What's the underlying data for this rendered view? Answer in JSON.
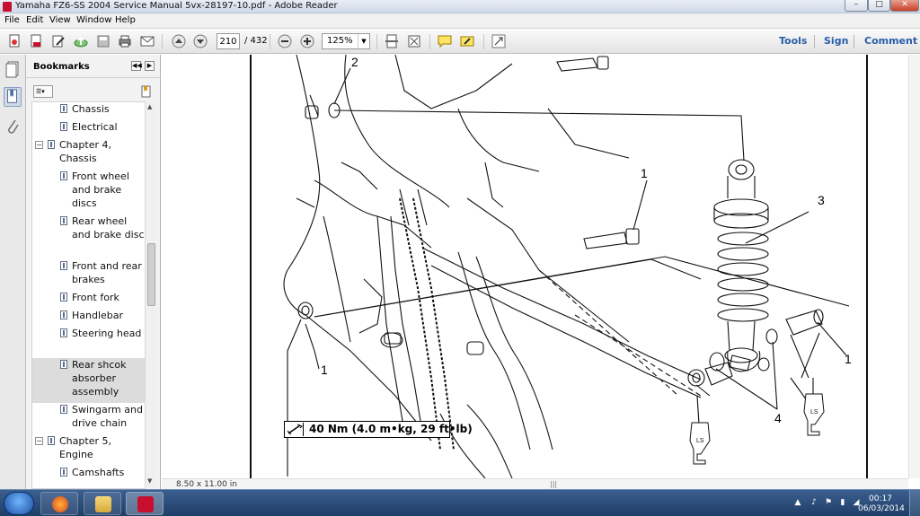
{
  "window": {
    "title": "Yamaha FZ6-SS 2004 Service Manual 5vx-28197-10.pdf - Adobe Reader",
    "minimize": "–",
    "maximize": "□",
    "close": "✕"
  },
  "menu": [
    "File",
    "Edit",
    "View",
    "Window",
    "Help"
  ],
  "toolbar": {
    "page_current": "210",
    "page_total": "/ 432",
    "zoom": "125%",
    "tools_label": "Tools",
    "sign_label": "Sign",
    "comment_label": "Comment"
  },
  "bookmarks": {
    "title": "Bookmarks",
    "items": [
      {
        "label": "Chassis",
        "level": 2
      },
      {
        "label": "Electrical",
        "level": 2
      },
      {
        "label": "Chapter 4, Chassis",
        "level": 1,
        "expanded": true
      },
      {
        "label": "Front wheel and brake discs",
        "level": 2
      },
      {
        "label": "Rear wheel and brake disc",
        "level": 2
      },
      {
        "label": "Front and rear brakes",
        "level": 2
      },
      {
        "label": "Front fork",
        "level": 2
      },
      {
        "label": "Handlebar",
        "level": 2
      },
      {
        "label": "Steering head",
        "level": 2
      },
      {
        "label": "Rear shcok absorber assembly",
        "level": 2,
        "selected": true
      },
      {
        "label": "Swingarm and drive chain",
        "level": 2
      },
      {
        "label": "Chapter 5, Engine",
        "level": 1,
        "expanded": true
      },
      {
        "label": "Camshafts",
        "level": 2
      }
    ]
  },
  "document": {
    "page_size": "8.50 x 11.00 in",
    "torque_spec": "40 Nm (4.0 m•kg, 29 ft•lb)",
    "callouts": [
      "1",
      "1",
      "1",
      "2",
      "3",
      "4"
    ],
    "lube_symbol": "LS"
  },
  "taskbar": {
    "time": "00:17",
    "date": "06/03/2014"
  },
  "colors": {
    "link_blue": "#2a5ea8",
    "acrobat_red": "#c8102e",
    "taskbar": "#2a4b78"
  }
}
